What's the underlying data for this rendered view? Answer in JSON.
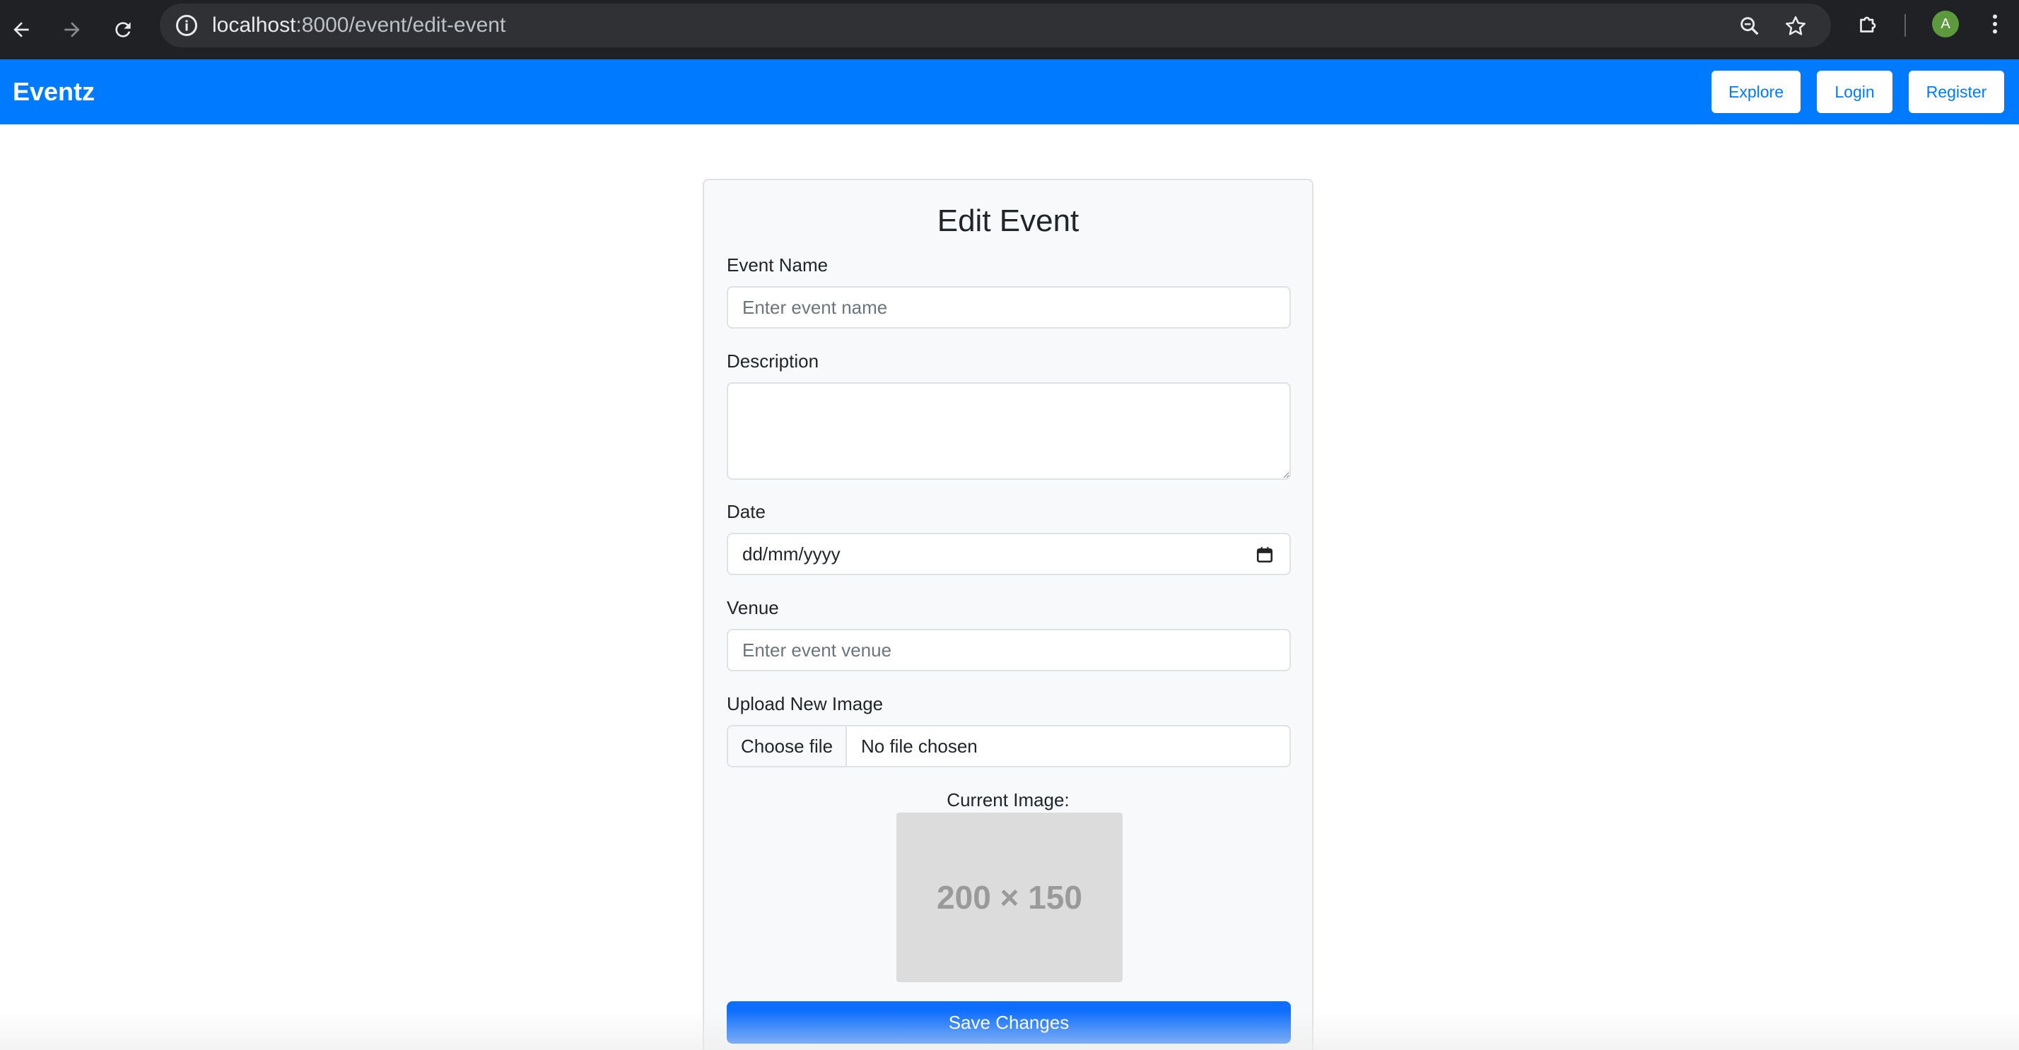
{
  "browser": {
    "url_host": "localhost",
    "url_path": ":8000/event/edit-event",
    "avatar_letter": "A",
    "icons": [
      "back-icon",
      "forward-icon",
      "reload-icon",
      "site-info-icon",
      "zoom-icon",
      "bookmark-star-icon",
      "extensions-icon",
      "more-menu-icon"
    ]
  },
  "navbar": {
    "brand": "Eventz",
    "links": [
      "Explore",
      "Login",
      "Register"
    ],
    "color": "#007bff"
  },
  "form": {
    "title": "Edit Event",
    "event_name_label": "Event Name",
    "event_name_placeholder": "Enter event name",
    "description_label": "Description",
    "date_label": "Date",
    "date_value": "dd/mm/yyyy",
    "venue_label": "Venue",
    "venue_placeholder": "Enter event venue",
    "upload_label": "Upload New Image",
    "choose_file": "Choose file",
    "no_file": "No file chosen",
    "current_image_label": "Current Image:",
    "current_image_text": "200 × 150",
    "save_button": "Save Changes",
    "save_color": "#0d6efd"
  }
}
